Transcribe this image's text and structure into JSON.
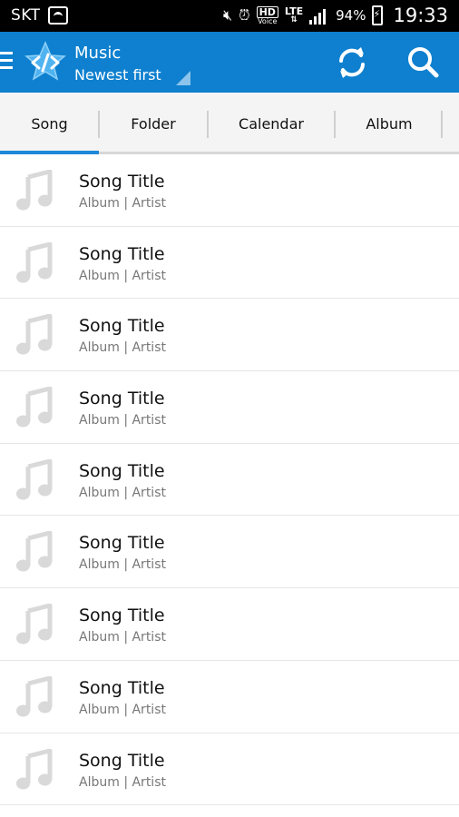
{
  "status_bar": {
    "carrier": "SKT",
    "hd": "HD",
    "voice": "Voice",
    "lte": "LTE",
    "battery_pct": "94%",
    "time": "19:33"
  },
  "app_bar": {
    "title": "Music",
    "subtitle": "Newest first",
    "accent_color": "#0e80cf"
  },
  "tabs": [
    {
      "label": "Song",
      "active": true
    },
    {
      "label": "Folder",
      "active": false
    },
    {
      "label": "Calendar",
      "active": false
    },
    {
      "label": "Album",
      "active": false
    }
  ],
  "songs": [
    {
      "title": "Song Title",
      "subtitle": "Album | Artist"
    },
    {
      "title": "Song Title",
      "subtitle": "Album | Artist"
    },
    {
      "title": "Song Title",
      "subtitle": "Album | Artist"
    },
    {
      "title": "Song Title",
      "subtitle": "Album | Artist"
    },
    {
      "title": "Song Title",
      "subtitle": "Album | Artist"
    },
    {
      "title": "Song Title",
      "subtitle": "Album | Artist"
    },
    {
      "title": "Song Title",
      "subtitle": "Album | Artist"
    },
    {
      "title": "Song Title",
      "subtitle": "Album | Artist"
    },
    {
      "title": "Song Title",
      "subtitle": "Album | Artist"
    }
  ]
}
